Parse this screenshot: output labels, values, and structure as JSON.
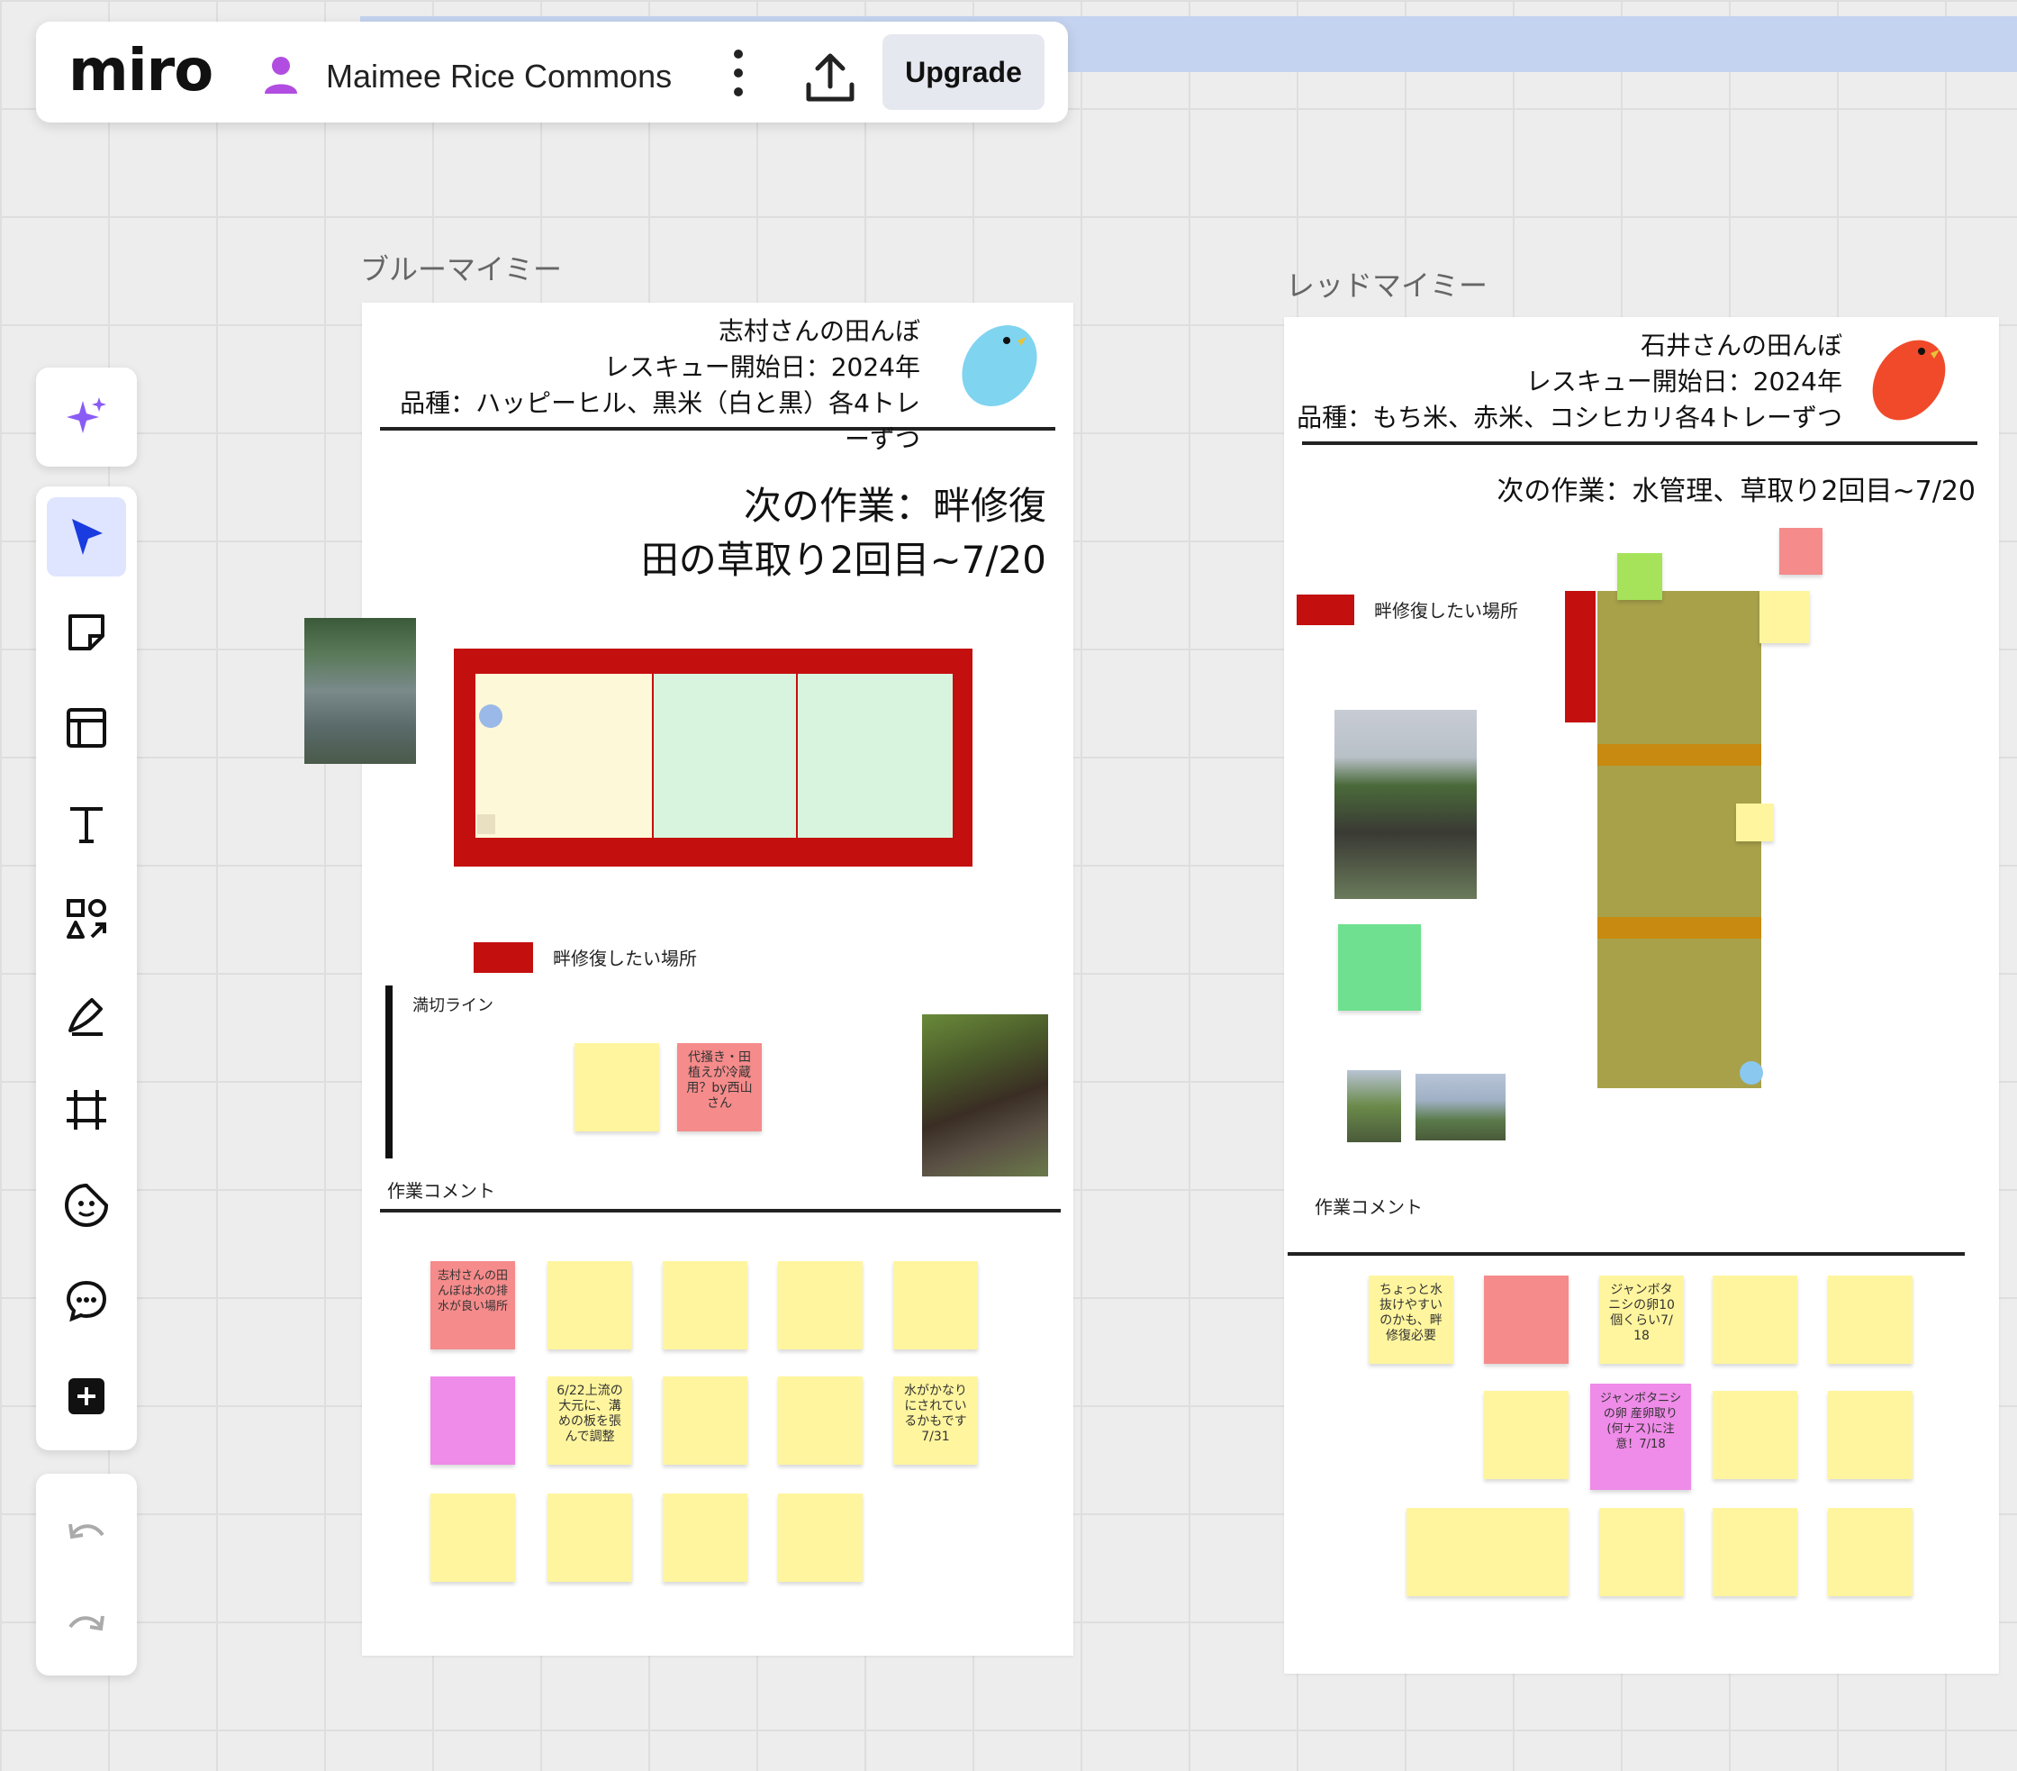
{
  "colors": {
    "accent": "#4262ff",
    "hazard_red": "#c40f0f",
    "bed_olive": "#a8a14a",
    "bed_strip": "#c88a10",
    "blue_bird": "#7fd4f0",
    "red_bird": "#f04a2a"
  },
  "header": {
    "logo": "miro",
    "board_name": "Maimee Rice Commons",
    "board_icon": "user-icon",
    "menu_icon": "more-vertical-icon",
    "share_icon": "upload-icon",
    "upgrade_label": "Upgrade"
  },
  "toolbar": {
    "ai_icon": "sparkle-icon",
    "tools": [
      "cursor-icon",
      "sticky-note-icon",
      "template-icon",
      "text-icon",
      "shapes-icon",
      "pen-icon",
      "frame-icon",
      "sticker-icon",
      "comment-icon",
      "add-icon"
    ],
    "active_tool": "cursor-icon",
    "undo_icon": "undo-icon",
    "redo_icon": "redo-icon"
  },
  "blue_frame": {
    "label": "ブルーマイミー",
    "owner_line": "志村さんの田んぼ",
    "start_line": "レスキュー開始日：2024年",
    "variety_line1": "品種：ハッピーヒル、黒米（白と黒）各4トレ",
    "variety_line2": "ーずつ",
    "next_task_line1": "次の作業：畔修復",
    "next_task_line2": "田の草取り2回目~7/20",
    "legend_label": "畔修復したい場所",
    "cutoff_label": "満切ライン",
    "comment_heading": "作業コメント",
    "sticky_texts": {
      "pink1": "代掻き・田植えが冷蔵用？by西山さん",
      "c1": "志村さんの田んぼは水の排水が良い場所",
      "c9": "6/22上流の大元に、溝めの板を張んで調整",
      "c13": "水がかなりにされているかもです7/31"
    }
  },
  "red_frame": {
    "label": "レッドマイミー",
    "owner_line": "石井さんの田んぼ",
    "start_line": "レスキュー開始日：2024年",
    "variety_line": "品種：もち米、赤米、コシヒカリ各4トレーずつ",
    "next_task": "次の作業：水管理、草取り2回目~7/20",
    "legend_label": "畔修復したい場所",
    "comment_heading": "作業コメント",
    "sticky_texts": {
      "s1": "ちょっと水抜けやすいのかも、畔修復必要",
      "s3": "ジャンボタニシの卵10個くらい7/18",
      "s7": "ジャンボタニシの卵 産卵取り(何ナス)に注意！7/18"
    }
  }
}
